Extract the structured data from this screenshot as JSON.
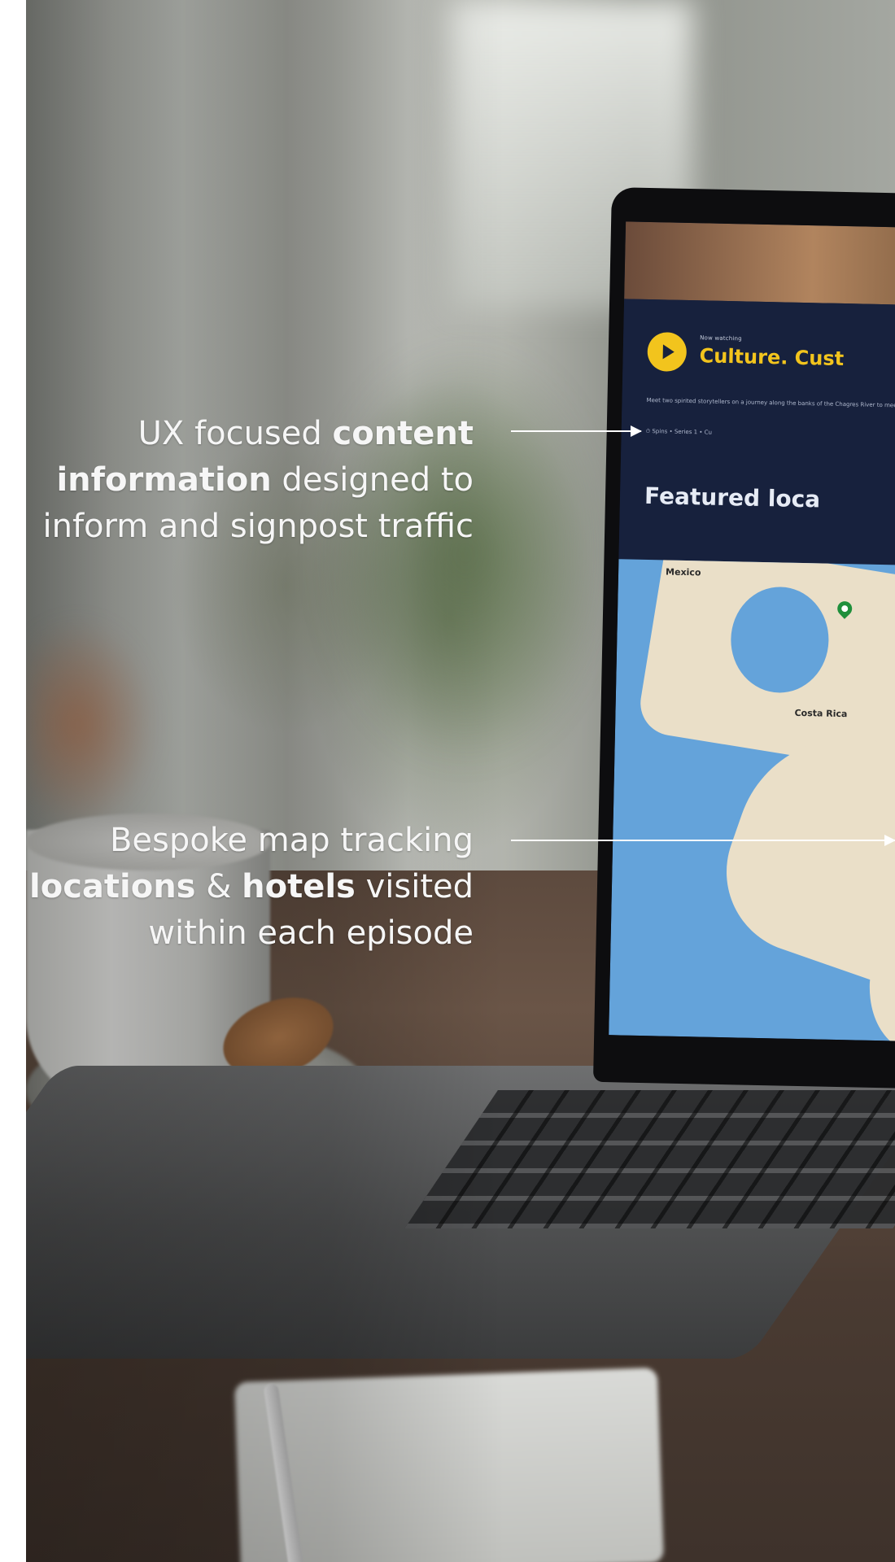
{
  "laptop_screen": {
    "eyebrow": "Now watching",
    "episode_title": "Culture. Cust",
    "description": "Meet two spirited storytellers on a journey along the banks of the Chagres River to meet the",
    "meta": "⏱ Spins  •  Series 1  •  Cu",
    "featured_heading": "Featured loca",
    "map_labels": {
      "top_left": "Mexico",
      "middle": "Costa Rica"
    }
  },
  "captions": [
    {
      "part1": "UX focused ",
      "bold1": "content information",
      "part2": " designed to inform and signpost traffic"
    },
    {
      "part1": "Bespoke map tracking ",
      "bold1": "locations",
      "part2": " & ",
      "bold2": "hotels",
      "part3": " visited within each episode"
    }
  ],
  "colors": {
    "accent_yellow": "#f2c41d",
    "navy": "#17213d",
    "map_water": "#64a3da",
    "map_land": "#eadfc8"
  },
  "icons": {
    "play": "play-icon",
    "map_pin": "map-pin-icon",
    "arrow": "arrow-right-icon"
  }
}
